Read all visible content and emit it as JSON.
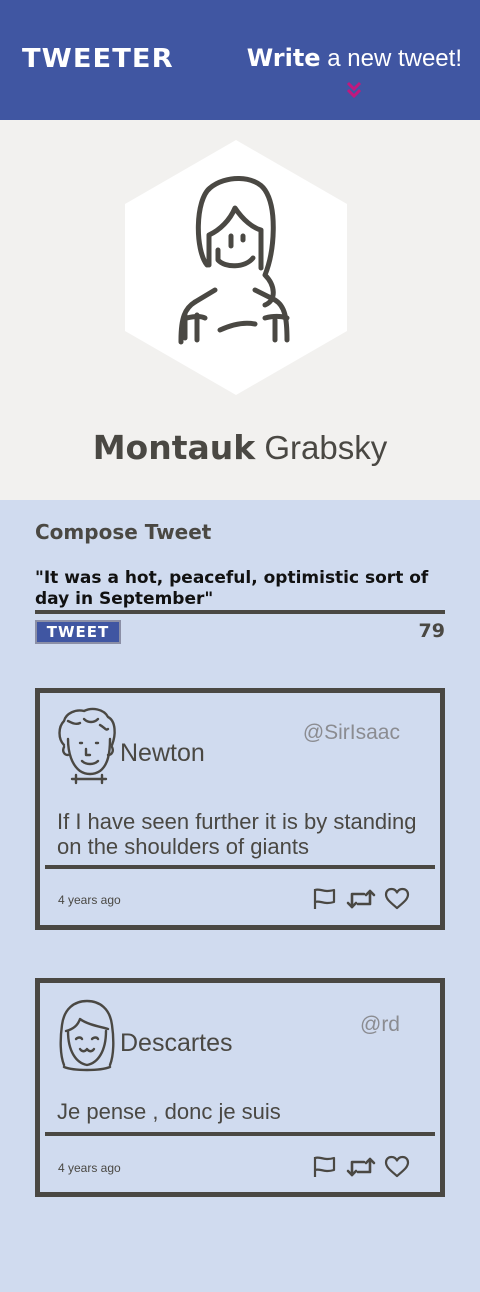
{
  "header": {
    "logo": "TWEETER",
    "compose_strong": "Write",
    "compose_rest": " a new tweet!"
  },
  "profile": {
    "first_name": "Montauk",
    "last_name": " Grabsky"
  },
  "compose": {
    "title": "Compose Tweet",
    "text": "\"It was a hot, peaceful, optimistic sort of day in September\"",
    "button_label": "TWEET",
    "char_counter": "79"
  },
  "tweets": [
    {
      "name": "Newton",
      "handle": "@SirIsaac",
      "content": "If I have seen further it is by standing on the shoulders of giants",
      "time": "4 years ago"
    },
    {
      "name": "Descartes",
      "handle": "@rd",
      "content": "Je pense , donc je suis",
      "time": "4 years ago"
    }
  ],
  "colors": {
    "header_bg": "#4056a2",
    "page_bg": "#d0dbef",
    "toggle_accent": "#c2187e",
    "text_dark": "#4a4843"
  },
  "icons": [
    "double-chevron-down-icon",
    "flag-icon",
    "retweet-icon",
    "heart-icon"
  ]
}
